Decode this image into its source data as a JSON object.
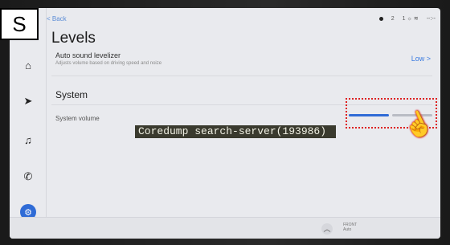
{
  "corner_label": "S",
  "header": {
    "back_label": "< Back",
    "title": "Levels"
  },
  "status": {
    "icons": [
      "dot",
      "person-icon",
      "signal-icon",
      "clock"
    ],
    "texts": [
      "2",
      "1 ☼ ≋",
      "--:--"
    ]
  },
  "auto_sound": {
    "title": "Auto sound levelizer",
    "subtitle": "Adjusts volume based on driving speed and noize",
    "value": "Low >"
  },
  "section_title": "System",
  "system_volume": {
    "label": "System volume",
    "level_fraction": 0.5
  },
  "overlay_text": "Coredump search-server(193986)",
  "bottom": {
    "front_label": "FRONT",
    "front_sub": "Auto"
  },
  "nav": [
    {
      "name": "home-icon",
      "glyph": "⌂"
    },
    {
      "name": "navigation-icon",
      "glyph": "➤"
    },
    {
      "name": "music-icon",
      "glyph": "♫"
    },
    {
      "name": "phone-icon",
      "glyph": "✆"
    },
    {
      "name": "settings-icon",
      "glyph": "⚙"
    }
  ],
  "colors": {
    "accent": "#2f6bd6",
    "highlight": "#dd2222"
  }
}
